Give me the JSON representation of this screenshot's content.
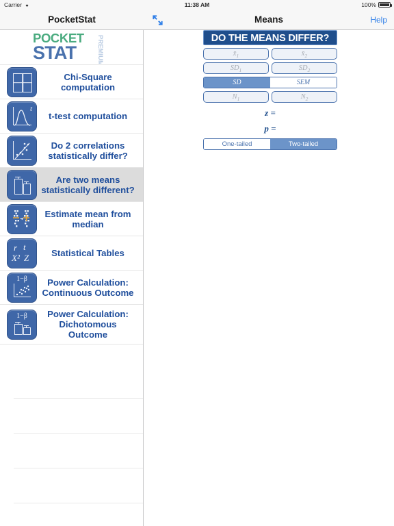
{
  "status_bar": {
    "carrier": "Carrier",
    "wifi_icon": "wifi-icon",
    "time": "11:38 AM",
    "battery_percent": "100%",
    "battery_icon": "battery-full-icon"
  },
  "sidebar_nav": {
    "title": "PocketStat"
  },
  "detail_nav": {
    "expand_icon": "expand-arrows-icon",
    "title": "Means",
    "help_label": "Help"
  },
  "logo": {
    "line1": "POCKET",
    "line2": "STAT",
    "badge": "PREMIUM",
    "color_green": "#4aab7f",
    "color_blue": "#4a72ad",
    "color_badge": "#b9cbe2"
  },
  "sidebar": {
    "items": [
      {
        "icon": "chi-square-grid-icon",
        "label": "Chi-Square\ncomputation",
        "selected": false
      },
      {
        "icon": "t-distribution-curve-icon",
        "label": "t-test computation",
        "selected": false
      },
      {
        "icon": "scatter-correlation-icon",
        "label": "Do 2 correlations\nstatistically differ?",
        "selected": false
      },
      {
        "icon": "two-bars-errorbars-icon",
        "label": "Are two means\nstatistically different?",
        "selected": true
      },
      {
        "icon": "dotplot-median-icon",
        "label": "Estimate mean from\nmedian",
        "selected": false
      },
      {
        "icon": "statistical-symbols-icon",
        "label": "Statistical Tables",
        "selected": false
      },
      {
        "icon": "power-scatter-icon",
        "label": "Power Calculation:\nContinuous Outcome",
        "selected": false
      },
      {
        "icon": "power-bars-icon",
        "label": "Power Calculation:\nDichotomous\nOutcome",
        "selected": false
      }
    ],
    "empty_row_count": 4
  },
  "means_form": {
    "title": "DO THE MEANS DIFFER?",
    "fields": [
      {
        "name": "mean1",
        "placeholder_base": "x̄",
        "placeholder_sub": "1",
        "value": ""
      },
      {
        "name": "mean2",
        "placeholder_base": "x̄",
        "placeholder_sub": "2",
        "value": ""
      },
      {
        "name": "sd1",
        "placeholder_base": "SD",
        "placeholder_sub": "1",
        "value": ""
      },
      {
        "name": "sd2",
        "placeholder_base": "SD",
        "placeholder_sub": "2",
        "value": ""
      },
      {
        "name": "n1",
        "placeholder_base": "N",
        "placeholder_sub": "1",
        "value": ""
      },
      {
        "name": "n2",
        "placeholder_base": "N",
        "placeholder_sub": "2",
        "value": ""
      }
    ],
    "dispersion_segment": {
      "options": [
        "SD",
        "SEM"
      ],
      "selected": "SD"
    },
    "tails_segment": {
      "options": [
        "One-tailed",
        "Two-tailed"
      ],
      "selected": "Two-tailed"
    },
    "results": {
      "z_label": "z =",
      "z_value": "",
      "p_label": "p =",
      "p_value": ""
    },
    "accent_dark": "#1f4e8c",
    "accent_mid": "#6c94c9"
  }
}
